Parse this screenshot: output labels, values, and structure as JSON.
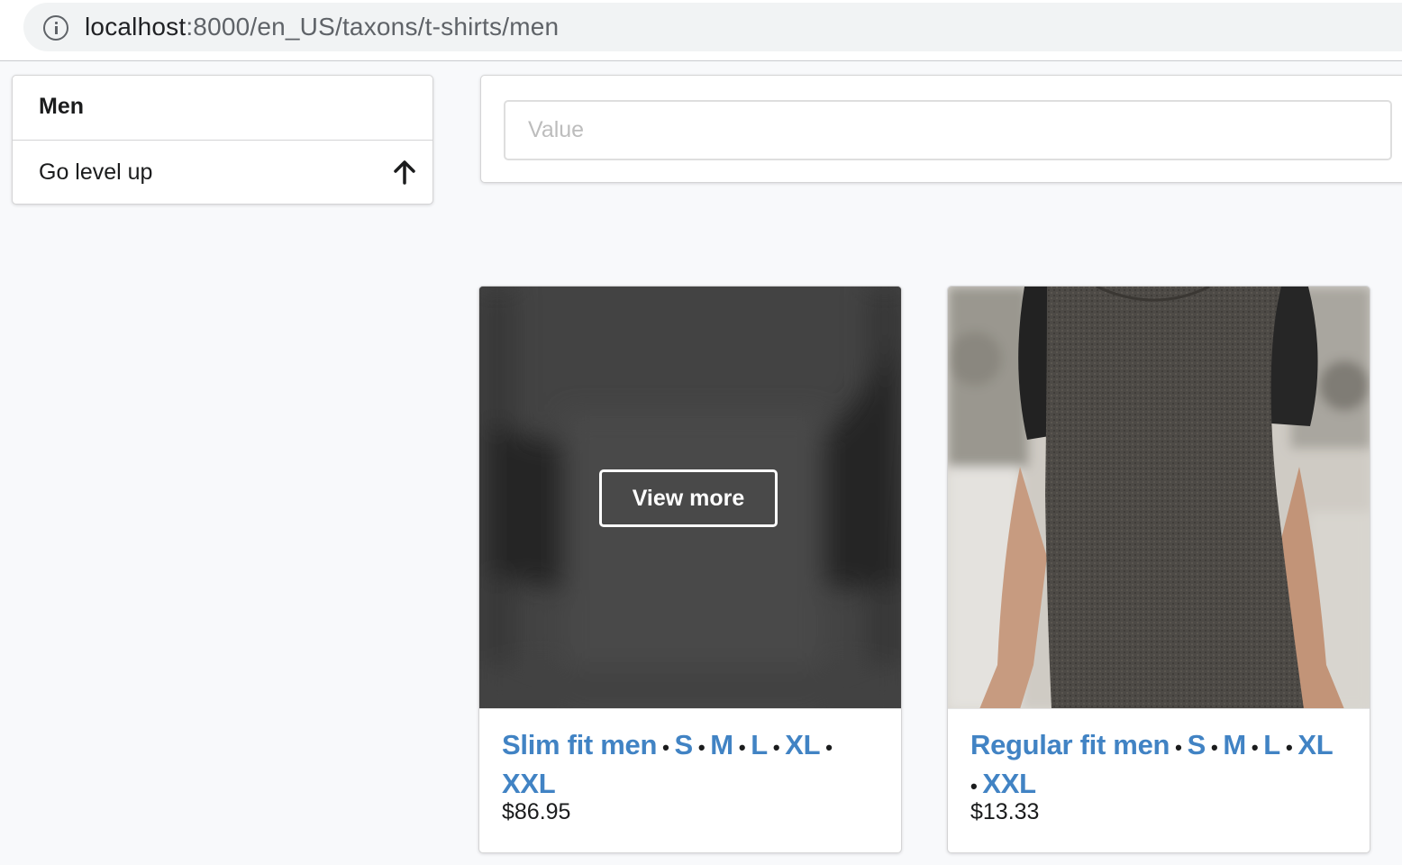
{
  "browser": {
    "url_host": "localhost",
    "url_path": ":8000/en_US/taxons/t-shirts/men"
  },
  "sidebar": {
    "title": "Men",
    "items": [
      {
        "label": "Go level up",
        "icon": "arrow-up-icon"
      }
    ]
  },
  "search": {
    "placeholder": "Value",
    "value": ""
  },
  "products": [
    {
      "name": "Slim fit men",
      "variants": [
        "S",
        "M",
        "L",
        "XL",
        "XXL"
      ],
      "price": "$86.95",
      "hover_button": "View more"
    },
    {
      "name": "Regular fit men",
      "variants": [
        "S",
        "M",
        "L",
        "XL",
        "XXL"
      ],
      "price": "$13.33"
    }
  ],
  "colors": {
    "link": "#4183c4",
    "text": "#1b1c1d",
    "border": "#d4d4d5",
    "page_bg": "#f8f9fb"
  }
}
